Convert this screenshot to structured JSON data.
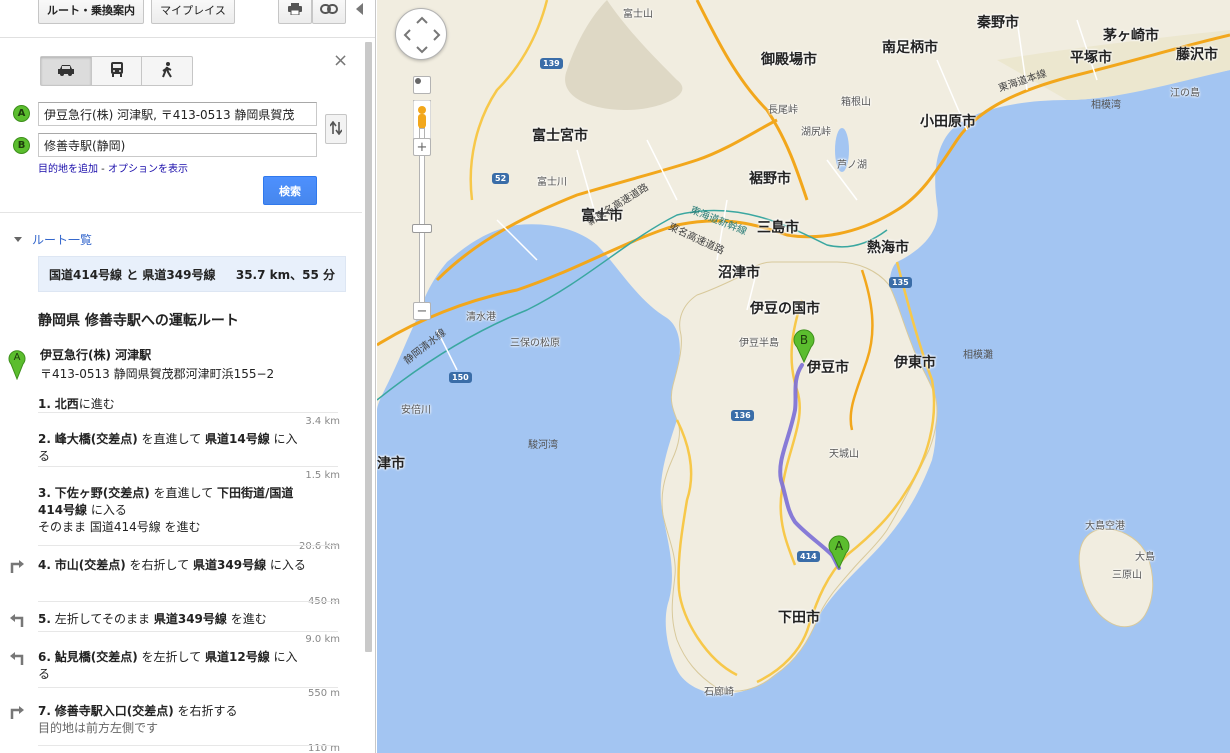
{
  "toolbar": {
    "route_button": "ルート・乗換案内",
    "myplaces_button": "マイプレイス",
    "print_icon": "printer-icon",
    "link_icon": "link-icon"
  },
  "travel_modes": [
    "car-icon",
    "bus-icon",
    "walk-icon"
  ],
  "form": {
    "origin_marker": "A",
    "destination_marker": "B",
    "origin_value": "伊豆急行(株) 河津駅, 〒413-0513 静岡県賀茂",
    "destination_value": "修善寺駅(静岡)",
    "add_destination": "目的地を追加",
    "separator": " - ",
    "show_options": "オプションを表示",
    "search_button": "検索"
  },
  "routes": {
    "heading": "ルート一覧",
    "summary_name": "国道414号線 と 県道349号線",
    "summary_stats": "35.7 km、55 分"
  },
  "directions": {
    "title": "静岡県 修善寺駅への運転ルート",
    "origin_name": "伊豆急行(株) 河津駅",
    "origin_address": "〒413-0513 静岡県賀茂郡河津町浜155−2",
    "steps": [
      {
        "n": "1.",
        "parts": [
          {
            "b": "北西"
          },
          {
            "t": "に進む"
          }
        ],
        "dist": "3.4 km"
      },
      {
        "n": "2.",
        "parts": [
          {
            "b": "峰大橋(交差点)"
          },
          {
            "t": " を直進して "
          },
          {
            "b": "県道14号線"
          },
          {
            "t": " に入る"
          }
        ],
        "dist": "1.5 km"
      },
      {
        "n": "3.",
        "parts": [
          {
            "b": "下佐ヶ野(交差点)"
          },
          {
            "t": " を直進して "
          },
          {
            "b": "下田街道/国道414号線"
          },
          {
            "t": " に入る"
          }
        ],
        "extra": "そのまま 国道414号線 を進む",
        "dist": "20.6 km"
      },
      {
        "n": "4.",
        "parts": [
          {
            "b": "市山(交差点)"
          },
          {
            "t": " を右折して "
          },
          {
            "b": "県道349号線"
          },
          {
            "t": " に入る"
          }
        ],
        "dist": "450 m"
      },
      {
        "n": "5.",
        "parts": [
          {
            "t": "左折してそのまま "
          },
          {
            "b": "県道349号線"
          },
          {
            "t": " を進む"
          }
        ],
        "dist": "9.0 km"
      },
      {
        "n": "6.",
        "parts": [
          {
            "b": "鮎見橋(交差点)"
          },
          {
            "t": " を左折して "
          },
          {
            "b": "県道12号線"
          },
          {
            "t": " に入る"
          }
        ],
        "dist": "550 m"
      },
      {
        "n": "7.",
        "parts": [
          {
            "b": "修善寺駅入口(交差点)"
          },
          {
            "t": " を右折する"
          }
        ],
        "extra": "目的地は前方左側です",
        "dist": "110 m"
      }
    ]
  },
  "map": {
    "cities": [
      "秦野市",
      "御殿場市",
      "南足柄市",
      "平塚市",
      "茅ヶ崎市",
      "藤沢市",
      "小田原市",
      "富士宮市",
      "裾野市",
      "三島市",
      "富士市",
      "熱海市",
      "沼津市",
      "伊豆の国市",
      "伊豆市",
      "伊東市",
      "下田市",
      "津市"
    ],
    "places": [
      "富士山",
      "箱根山",
      "長尾峠",
      "湖尻峠",
      "芦ノ湖",
      "富士川",
      "駿河湾",
      "相模湾",
      "相模灘",
      "伊豆半島",
      "天城山",
      "大島空港",
      "大島",
      "三原山",
      "清水港",
      "三保の松原",
      "安倍川",
      "石廊崎",
      "江の島"
    ],
    "road_labels": [
      "新東名高速道路",
      "東名高速道路",
      "東海道本線",
      "東海道新幹線",
      "静岡清水線"
    ],
    "route_shields": [
      "139",
      "52",
      "135",
      "136",
      "414",
      "150"
    ],
    "controls": [
      "pan-control",
      "pegman-icon",
      "zoom-in-button",
      "zoom-out-button"
    ],
    "route_color": "#7b6ed6",
    "marker_color": "#5bbd2e",
    "water_color": "#a3c5f2"
  }
}
